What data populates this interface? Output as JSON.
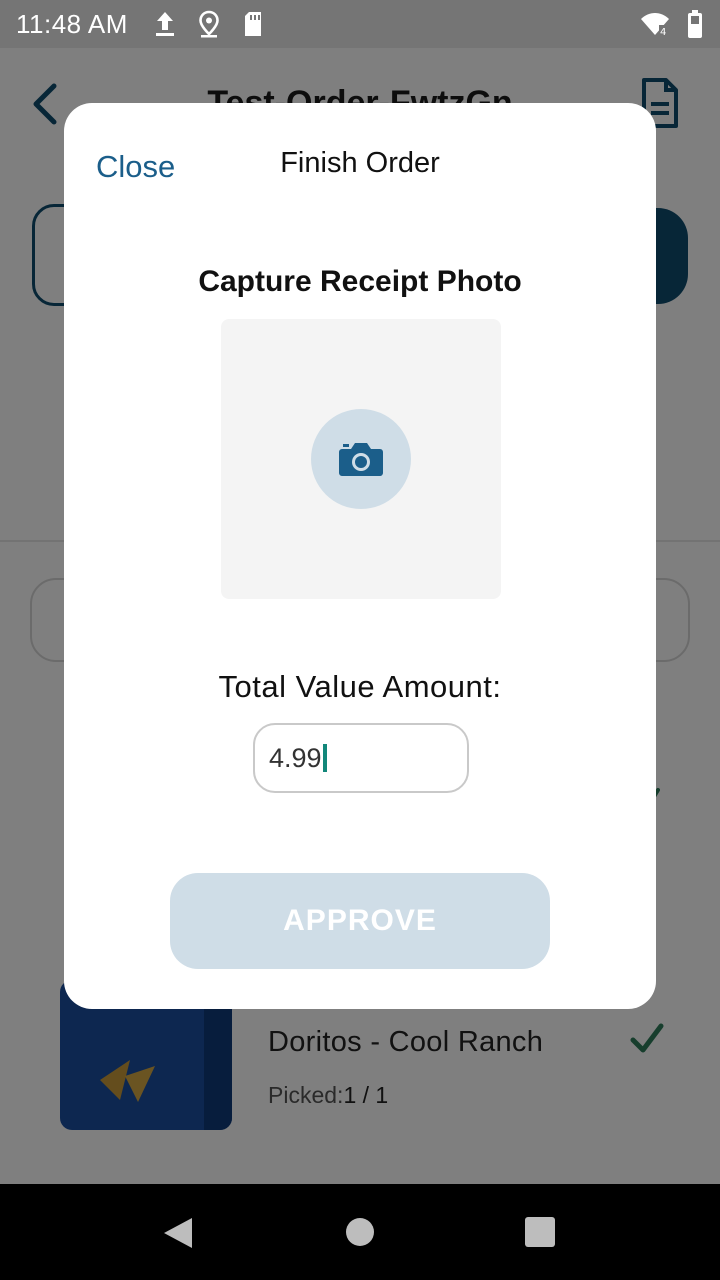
{
  "status_bar": {
    "time": "11:48 AM"
  },
  "background": {
    "title": "Test-Order-FwtzGn",
    "item": {
      "name": "Doritos - Cool Ranch",
      "picked_label": "Picked:",
      "picked_value": "1 / 1"
    }
  },
  "modal": {
    "close_label": "Close",
    "title": "Finish Order",
    "photo_section_title": "Capture Receipt Photo",
    "amount_label": "Total Value Amount:",
    "amount_value": "4.99",
    "approve_label": "APPROVE"
  },
  "colors": {
    "accent": "#1b5e8a",
    "primary_dark": "#0f4c6e",
    "disabled_button": "#cfdde7",
    "check_green": "#2e7d5b",
    "caret": "#12877a"
  },
  "icons": {
    "camera": "camera-icon",
    "back": "back-chevron-icon",
    "document": "document-icon",
    "check": "check-icon"
  }
}
